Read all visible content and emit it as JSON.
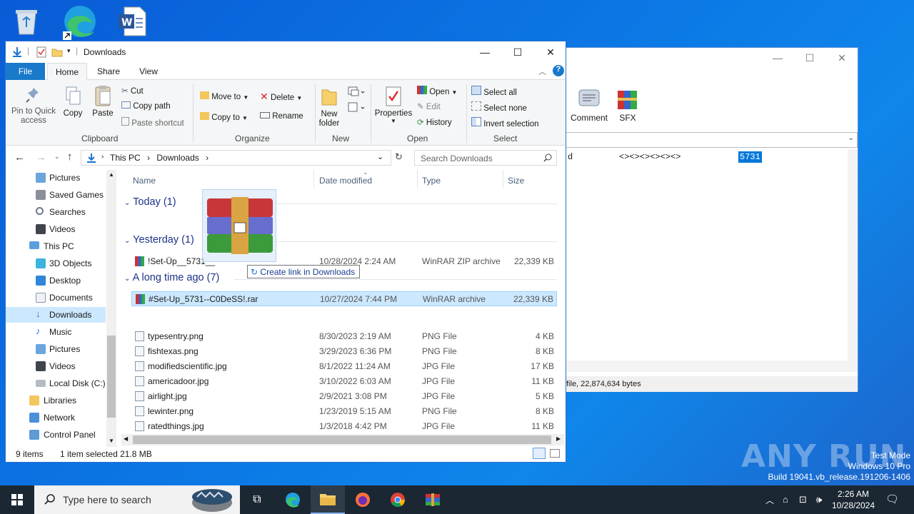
{
  "desktop": {
    "icons": [
      "recycle-bin",
      "edge",
      "word"
    ]
  },
  "bg_window": {
    "toolbar": [
      "Comment",
      "SFX"
    ],
    "list_row": {
      "col1": "d",
      "col2": "<><><><><><>",
      "col3": "5731"
    },
    "status": "file, 22,874,634 bytes"
  },
  "explorer": {
    "title": "Downloads",
    "tabs": [
      "File",
      "Home",
      "Share",
      "View"
    ],
    "ribbon": {
      "pin": "Pin to Quick access",
      "copy": "Copy",
      "paste": "Paste",
      "cut": "Cut",
      "copy_path": "Copy path",
      "paste_shortcut": "Paste shortcut",
      "move_to": "Move to",
      "copy_to": "Copy to",
      "delete": "Delete",
      "rename": "Rename",
      "new_folder": "New folder",
      "properties": "Properties",
      "open": "Open",
      "edit": "Edit",
      "history": "History",
      "select_all": "Select all",
      "select_none": "Select none",
      "invert_selection": "Invert selection",
      "groups": {
        "clipboard": "Clipboard",
        "organize": "Organize",
        "new": "New",
        "open": "Open",
        "select": "Select"
      }
    },
    "address": {
      "this_pc": "This PC",
      "downloads": "Downloads",
      "search_placeholder": "Search Downloads"
    },
    "nav": [
      "Pictures",
      "Saved Games",
      "Searches",
      "Videos",
      "This PC",
      "3D Objects",
      "Desktop",
      "Documents",
      "Downloads",
      "Music",
      "Pictures",
      "Videos",
      "Local Disk (C:)",
      "Libraries",
      "Network",
      "Control Panel"
    ],
    "columns": {
      "name": "Name",
      "date": "Date modified",
      "type": "Type",
      "size": "Size"
    },
    "groups": {
      "today": "Today (1)",
      "yesterday": "Yesterday (1)",
      "older": "A long time ago (7)"
    },
    "today_files": [
      {
        "name": "!Set-Üp__5731__",
        "date": "10/28/2024 2:24 AM",
        "type": "WinRAR ZIP archive",
        "size": "22,339 KB"
      }
    ],
    "yesterday_files": [
      {
        "name": "#Set-Up_5731--C0DeSS!.rar",
        "date": "10/27/2024 7:44 PM",
        "type": "WinRAR archive",
        "size": "22,339 KB"
      }
    ],
    "older_files": [
      {
        "name": "typesentry.png",
        "date": "8/30/2023 2:19 AM",
        "type": "PNG File",
        "size": "4 KB"
      },
      {
        "name": "fishtexas.png",
        "date": "3/29/2023 6:36 PM",
        "type": "PNG File",
        "size": "8 KB"
      },
      {
        "name": "modifiedscientific.jpg",
        "date": "8/1/2022 11:24 AM",
        "type": "JPG File",
        "size": "17 KB"
      },
      {
        "name": "americadoor.jpg",
        "date": "3/10/2022 6:03 AM",
        "type": "JPG File",
        "size": "11 KB"
      },
      {
        "name": "airlight.jpg",
        "date": "2/9/2021 3:08 PM",
        "type": "JPG File",
        "size": "5 KB"
      },
      {
        "name": "lewinter.png",
        "date": "1/23/2019 5:15 AM",
        "type": "PNG File",
        "size": "8 KB"
      },
      {
        "name": "ratedthings.jpg",
        "date": "1/3/2018 4:42 PM",
        "type": "JPG File",
        "size": "11 KB"
      }
    ],
    "drag_tooltip": "Create link in Downloads",
    "status": {
      "count": "9 items",
      "selected": "1 item selected  21.8 MB"
    }
  },
  "watermark": {
    "brand": "ANY RUN",
    "mode": "Test Mode",
    "os": "Windows 10 Pro",
    "build": "Build 19041.vb_release.191206-1406"
  },
  "taskbar": {
    "search_placeholder": "Type here to search",
    "time": "2:26 AM",
    "date": "10/28/2024"
  }
}
